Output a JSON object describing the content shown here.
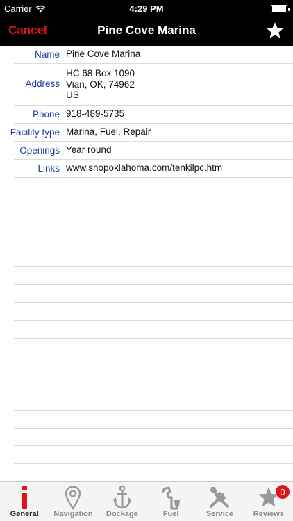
{
  "status_bar": {
    "carrier": "Carrier",
    "time": "4:29 PM",
    "battery_level": 1.0
  },
  "nav": {
    "cancel_label": "Cancel",
    "title": "Pine Cove Marina",
    "favorite_icon": "star-icon"
  },
  "details": {
    "name_label": "Name",
    "name_value": "Pine Cove Marina",
    "address_label": "Address",
    "address_lines": [
      "HC 68 Box 1090",
      "Vian, OK, 74962",
      "US"
    ],
    "phone_label": "Phone",
    "phone_value": "918-489-5735",
    "facility_label": "Facility type",
    "facility_value": "Marina, Fuel, Repair",
    "openings_label": "Openings",
    "openings_value": "Year round",
    "links_label": "Links",
    "links_value": "www.shopoklahoma.com/tenkilpc.htm"
  },
  "tabs": [
    {
      "label": "General",
      "icon": "info-icon",
      "active": true
    },
    {
      "label": "Navigation",
      "icon": "map-pin-icon"
    },
    {
      "label": "Dockage",
      "icon": "anchor-icon"
    },
    {
      "label": "Fuel",
      "icon": "fuel-nozzle-icon"
    },
    {
      "label": "Service",
      "icon": "tools-icon"
    },
    {
      "label": "Reviews",
      "icon": "star-icon",
      "badge": "0"
    }
  ],
  "colors": {
    "accent": "#e0141e",
    "label_blue": "#1a3c9b"
  }
}
